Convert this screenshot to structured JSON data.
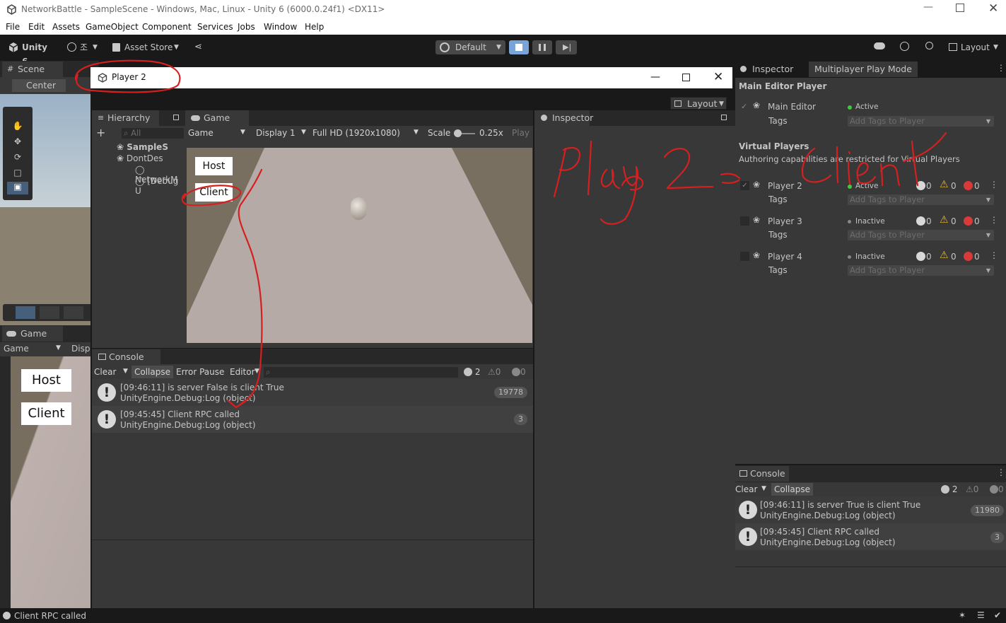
{
  "window": {
    "title": "NetworkBattle - SampleScene - Windows, Mac, Linux - Unity 6 (6000.0.24f1) <DX11>"
  },
  "menu": [
    "File",
    "Edit",
    "Assets",
    "GameObject",
    "Component",
    "Services",
    "Jobs",
    "Window",
    "Help"
  ],
  "toolbar": {
    "unity_label": "Unity 6",
    "account_label": "조",
    "asset_store": "Asset Store",
    "profile": "Default",
    "layout": "Layout"
  },
  "left": {
    "scene_tab": "Scene",
    "center_label": "Center",
    "game_tab": "Game",
    "game_dropdown": "Game",
    "display_trunc": "Displ",
    "host": "Host",
    "client": "Client"
  },
  "player_window": {
    "title": "Player 2",
    "layout": "Layout",
    "hierarchy_tab": "Hierarchy",
    "search_placeholder": "All",
    "hierarchy_items": [
      "SampleS",
      "DontDes",
      "NetworkM",
      "[Debug U"
    ],
    "game_tab": "Game",
    "game_dropdown": "Game",
    "display": "Display 1",
    "resolution": "Full HD (1920x1080)",
    "scale_label": "Scale",
    "scale_value": "0.25x",
    "play": "Play",
    "host": "Host",
    "client": "Client",
    "inspector_tab": "Inspector",
    "console": {
      "tab": "Console",
      "clear": "Clear",
      "collapse": "Collapse",
      "error_pause": "Error Pause",
      "editor": "Editor",
      "count_log": "2",
      "count_warn": "0",
      "count_err": "0",
      "entries": [
        {
          "line1": "[09:46:11] is server False is client True",
          "line2": "UnityEngine.Debug:Log (object)",
          "count": "19778"
        },
        {
          "line1": "[09:45:45] Client RPC called",
          "line2": "UnityEngine.Debug:Log (object)",
          "count": "3"
        }
      ]
    }
  },
  "right": {
    "inspector_tab": "Inspector",
    "mppm_tab": "Multiplayer Play Mode",
    "main_editor_header": "Main Editor Player",
    "main_editor_name": "Main Editor",
    "main_editor_status": "Active",
    "tags_label": "Tags",
    "tags_placeholder": "Add Tags to Player",
    "virtual_header": "Virtual Players",
    "virtual_note": "Authoring capabilities are restricted for Virtual Players",
    "players": [
      {
        "name": "Player 2",
        "status": "Active",
        "log": "0",
        "warn": "0",
        "err": "0"
      },
      {
        "name": "Player 3",
        "status": "Inactive",
        "log": "0",
        "warn": "0",
        "err": "0"
      },
      {
        "name": "Player 4",
        "status": "Inactive",
        "log": "0",
        "warn": "0",
        "err": "0"
      }
    ],
    "console": {
      "tab": "Console",
      "clear": "Clear",
      "collapse": "Collapse",
      "count_log": "2",
      "count_warn": "0",
      "count_err": "0",
      "entries": [
        {
          "line1": "[09:46:11] is server True is client True",
          "line2": "UnityEngine.Debug:Log (object)",
          "count": "11980"
        },
        {
          "line1": "[09:45:45] Client RPC called",
          "line2": "UnityEngine.Debug:Log (object)",
          "count": "3"
        }
      ]
    }
  },
  "status": {
    "message": "Client RPC called"
  },
  "colors": {
    "annotation": "#d42020",
    "active_dot": "#3ec93e"
  }
}
